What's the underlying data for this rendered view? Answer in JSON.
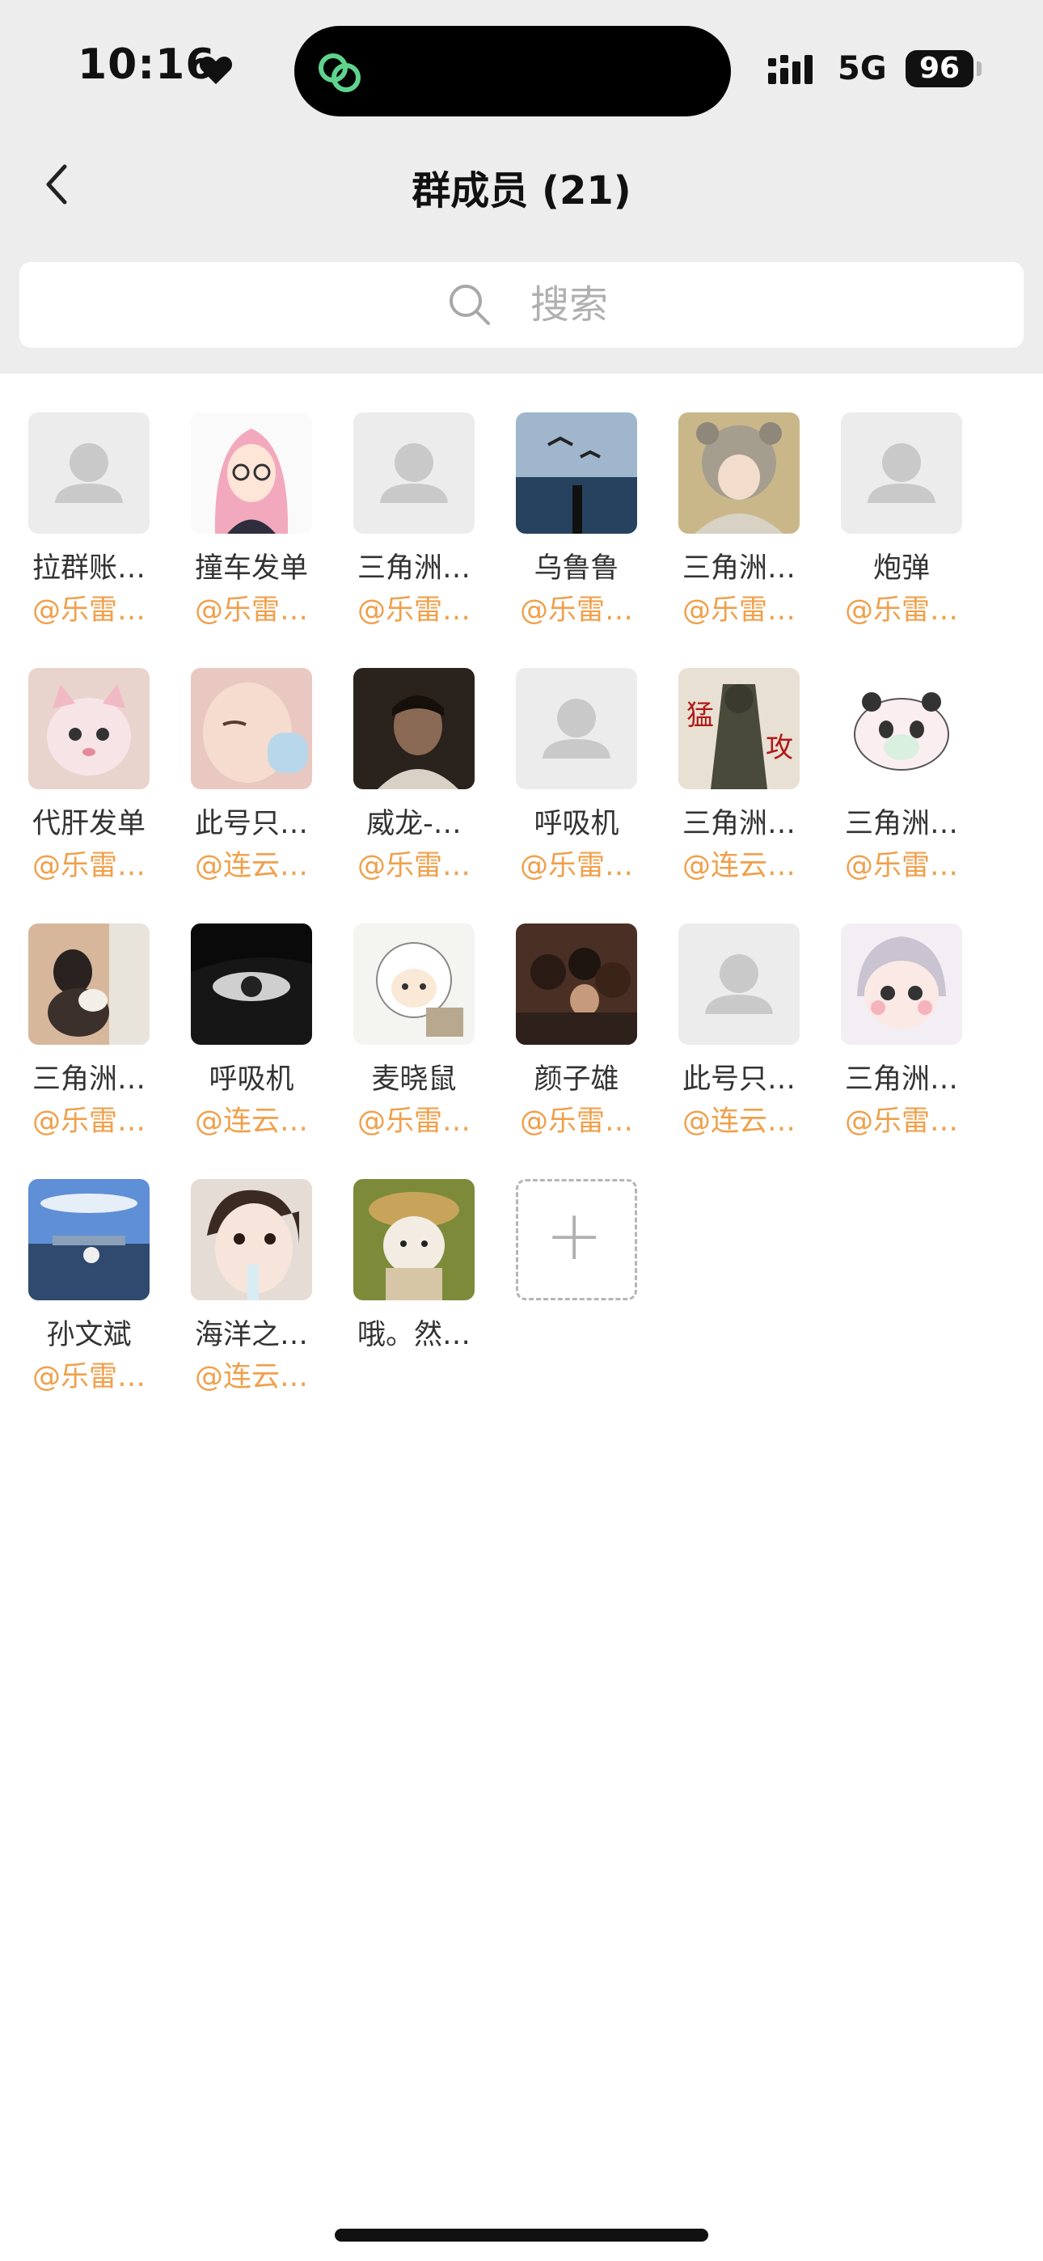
{
  "status_bar": {
    "time": "10:16",
    "network": "5G",
    "battery": "96"
  },
  "nav": {
    "title": "群成员 (21)"
  },
  "search": {
    "placeholder": "搜索"
  },
  "colors": {
    "group_tag": "#f0a04b",
    "background_top": "#ededed",
    "island_icon": "#5fd38d"
  },
  "members": [
    {
      "name": "拉群账…",
      "group": "@乐雷…",
      "avatar": "default-avatar-icon"
    },
    {
      "name": "撞车发单",
      "group": "@乐雷…",
      "avatar": "anime-girl-avatar"
    },
    {
      "name": "三角洲…",
      "group": "@乐雷…",
      "avatar": "default-avatar-icon"
    },
    {
      "name": "乌鲁鲁",
      "group": "@乐雷…",
      "avatar": "seagull-sea-photo"
    },
    {
      "name": "三角洲…",
      "group": "@乐雷…",
      "avatar": "bear-hat-girl-photo"
    },
    {
      "name": "炮弹",
      "group": "@乐雷…",
      "avatar": "default-avatar-icon"
    },
    {
      "name": "代肝发单",
      "group": "@乐雷…",
      "avatar": "pink-cat-photo"
    },
    {
      "name": "此号只…",
      "group": "@连云…",
      "avatar": "girl-face-photo"
    },
    {
      "name": "威龙-…",
      "group": "@乐雷…",
      "avatar": "dark-portrait-photo"
    },
    {
      "name": "呼吸机",
      "group": "@乐雷…",
      "avatar": "default-avatar-icon"
    },
    {
      "name": "三角洲…",
      "group": "@连云…",
      "avatar": "soldier-poster"
    },
    {
      "name": "三角洲…",
      "group": "@乐雷…",
      "avatar": "panda-cartoon"
    },
    {
      "name": "三角洲…",
      "group": "@乐雷…",
      "avatar": "girl-with-dog-photo"
    },
    {
      "name": "呼吸机",
      "group": "@连云…",
      "avatar": "dark-eye-photo"
    },
    {
      "name": "麦晓鼠",
      "group": "@乐雷…",
      "avatar": "sheep-cartoon"
    },
    {
      "name": "颜子雄",
      "group": "@乐雷…",
      "avatar": "crowd-photo"
    },
    {
      "name": "此号只…",
      "group": "@连云…",
      "avatar": "default-avatar-icon"
    },
    {
      "name": "三角洲…",
      "group": "@乐雷…",
      "avatar": "chibi-character"
    },
    {
      "name": "孙文斌",
      "group": "@乐雷…",
      "avatar": "lake-boat-photo"
    },
    {
      "name": "海洋之…",
      "group": "@连云…",
      "avatar": "toddler-photo"
    },
    {
      "name": "哦。然…",
      "group": "",
      "avatar": "plush-toy-photo"
    }
  ],
  "add_member": {
    "icon": "plus-icon"
  }
}
